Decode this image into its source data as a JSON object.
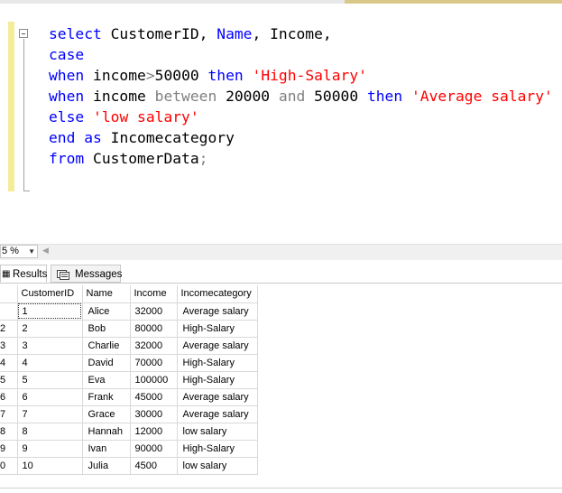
{
  "editor": {
    "lines": [
      [
        {
          "t": "select",
          "c": "kw"
        },
        {
          "t": " CustomerID, "
        },
        {
          "t": "Name",
          "c": "kw"
        },
        {
          "t": ", Income,"
        }
      ],
      [
        {
          "t": "case",
          "c": "kw"
        }
      ],
      [
        {
          "t": "when",
          "c": "kw"
        },
        {
          "t": " income"
        },
        {
          "t": ">",
          "c": "op"
        },
        {
          "t": "50000 "
        },
        {
          "t": "then",
          "c": "kw"
        },
        {
          "t": " "
        },
        {
          "t": "'High-Salary'",
          "c": "str"
        }
      ],
      [
        {
          "t": "when",
          "c": "kw"
        },
        {
          "t": " income "
        },
        {
          "t": "between",
          "c": "op"
        },
        {
          "t": " 20000 "
        },
        {
          "t": "and",
          "c": "op"
        },
        {
          "t": " 50000 "
        },
        {
          "t": "then",
          "c": "kw"
        },
        {
          "t": " "
        },
        {
          "t": "'Average salary'",
          "c": "str"
        }
      ],
      [
        {
          "t": "else",
          "c": "kw"
        },
        {
          "t": " "
        },
        {
          "t": "'low salary'",
          "c": "str"
        }
      ],
      [
        {
          "t": "end",
          "c": "kw"
        },
        {
          "t": " "
        },
        {
          "t": "as",
          "c": "kw"
        },
        {
          "t": " Incomecategory"
        }
      ],
      [
        {
          "t": "from",
          "c": "kw"
        },
        {
          "t": " CustomerData"
        },
        {
          "t": ";",
          "c": "op"
        }
      ]
    ]
  },
  "zoom": {
    "value": "5 %"
  },
  "tabs": {
    "results": "Results",
    "messages": "Messages"
  },
  "grid": {
    "columns": [
      "CustomerID",
      "Name",
      "Income",
      "Incomecategory"
    ],
    "rows": [
      {
        "rn": "",
        "cells": [
          "1",
          "Alice",
          "32000",
          "Average salary"
        ]
      },
      {
        "rn": "2",
        "cells": [
          "2",
          "Bob",
          "80000",
          "High-Salary"
        ]
      },
      {
        "rn": "3",
        "cells": [
          "3",
          "Charlie",
          "32000",
          "Average salary"
        ]
      },
      {
        "rn": "4",
        "cells": [
          "4",
          "David",
          "70000",
          "High-Salary"
        ]
      },
      {
        "rn": "5",
        "cells": [
          "5",
          "Eva",
          "100000",
          "High-Salary"
        ]
      },
      {
        "rn": "6",
        "cells": [
          "6",
          "Frank",
          "45000",
          "Average salary"
        ]
      },
      {
        "rn": "7",
        "cells": [
          "7",
          "Grace",
          "30000",
          "Average salary"
        ]
      },
      {
        "rn": "8",
        "cells": [
          "8",
          "Hannah",
          "12000",
          "low salary"
        ]
      },
      {
        "rn": "9",
        "cells": [
          "9",
          "Ivan",
          "90000",
          "High-Salary"
        ]
      },
      {
        "rn": "0",
        "cells": [
          "10",
          "Julia",
          "4500",
          "low salary"
        ]
      }
    ]
  }
}
